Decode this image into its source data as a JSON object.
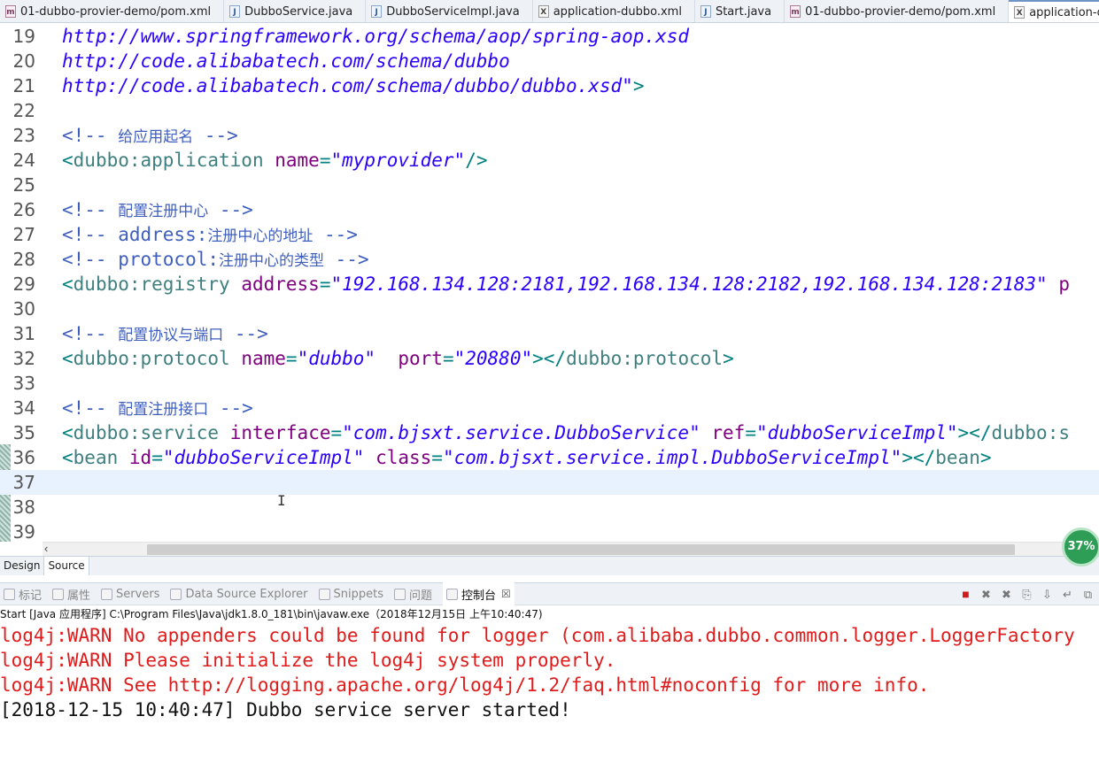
{
  "editor_tabs": [
    {
      "label": "01-dubbo-provier-demo/pom.xml",
      "icon": "maven-pom-icon",
      "type": "m"
    },
    {
      "label": "DubboService.java",
      "icon": "java-file-icon",
      "type": "j"
    },
    {
      "label": "DubboServiceImpl.java",
      "icon": "java-file-icon",
      "type": "j"
    },
    {
      "label": "application-dubbo.xml",
      "icon": "xml-file-icon",
      "type": "x"
    },
    {
      "label": "Start.java",
      "icon": "java-file-icon",
      "type": "j"
    },
    {
      "label": "01-dubbo-provier-demo/pom.xml",
      "icon": "maven-pom-icon",
      "type": "m"
    },
    {
      "label": "application-dubb",
      "icon": "xml-file-icon",
      "type": "x",
      "active": true
    }
  ],
  "code_lines": [
    {
      "n": "19",
      "segs": [
        [
          "url",
          "http://www.springframework.org/schema/aop/spring-aop.xsd"
        ]
      ]
    },
    {
      "n": "20",
      "segs": [
        [
          "url",
          "http://code.alibabatech.com/schema/dubbo"
        ]
      ]
    },
    {
      "n": "21",
      "segs": [
        [
          "url",
          "http://code.alibabatech.com/schema/dubbo/dubbo.xsd"
        ],
        [
          "val",
          "\""
        ],
        [
          "punct",
          ">"
        ]
      ]
    },
    {
      "n": "22",
      "segs": []
    },
    {
      "n": "23",
      "segs": [
        [
          "cmt",
          "<!-- "
        ],
        [
          "cmt-cn",
          "给应用起名"
        ],
        [
          "cmt",
          " -->"
        ]
      ]
    },
    {
      "n": "24",
      "segs": [
        [
          "punct",
          "<"
        ],
        [
          "tag",
          "dubbo:application"
        ],
        [
          "plain",
          " "
        ],
        [
          "attr",
          "name"
        ],
        [
          "punct",
          "="
        ],
        [
          "val",
          "\"myprovider\""
        ],
        [
          "punct",
          "/>"
        ]
      ]
    },
    {
      "n": "25",
      "segs": []
    },
    {
      "n": "26",
      "segs": [
        [
          "cmt",
          "<!-- "
        ],
        [
          "cmt-cn",
          "配置注册中心"
        ],
        [
          "cmt",
          " -->"
        ]
      ]
    },
    {
      "n": "27",
      "segs": [
        [
          "cmt",
          "<!-- address:"
        ],
        [
          "cmt-cn",
          "注册中心的地址"
        ],
        [
          "cmt",
          " -->"
        ]
      ]
    },
    {
      "n": "28",
      "segs": [
        [
          "cmt",
          "<!-- protocol:"
        ],
        [
          "cmt-cn",
          "注册中心的类型"
        ],
        [
          "cmt",
          " -->"
        ]
      ]
    },
    {
      "n": "29",
      "segs": [
        [
          "punct",
          "<"
        ],
        [
          "tag",
          "dubbo:registry"
        ],
        [
          "plain",
          " "
        ],
        [
          "attr",
          "address"
        ],
        [
          "punct",
          "="
        ],
        [
          "val",
          "\"192.168.134.128:2181,192.168.134.128:2182,192.168.134.128:2183\""
        ],
        [
          "plain",
          " "
        ],
        [
          "attr",
          "p"
        ]
      ]
    },
    {
      "n": "30",
      "segs": []
    },
    {
      "n": "31",
      "segs": [
        [
          "cmt",
          "<!-- "
        ],
        [
          "cmt-cn",
          "配置协议与端口"
        ],
        [
          "cmt",
          " -->"
        ]
      ]
    },
    {
      "n": "32",
      "segs": [
        [
          "punct",
          "<"
        ],
        [
          "tag",
          "dubbo:protocol"
        ],
        [
          "plain",
          " "
        ],
        [
          "attr",
          "name"
        ],
        [
          "punct",
          "="
        ],
        [
          "val",
          "\"dubbo\""
        ],
        [
          "plain",
          "  "
        ],
        [
          "attr",
          "port"
        ],
        [
          "punct",
          "="
        ],
        [
          "val",
          "\"20880\""
        ],
        [
          "punct",
          "></"
        ],
        [
          "tag",
          "dubbo:protocol"
        ],
        [
          "punct",
          ">"
        ]
      ]
    },
    {
      "n": "33",
      "segs": []
    },
    {
      "n": "34",
      "segs": [
        [
          "cmt",
          "<!-- "
        ],
        [
          "cmt-cn",
          "配置注册接口"
        ],
        [
          "cmt",
          " -->"
        ]
      ]
    },
    {
      "n": "35",
      "segs": [
        [
          "punct",
          "<"
        ],
        [
          "tag",
          "dubbo:service"
        ],
        [
          "plain",
          " "
        ],
        [
          "attr",
          "interface"
        ],
        [
          "punct",
          "="
        ],
        [
          "val",
          "\"com.bjsxt.service.DubboService\""
        ],
        [
          "plain",
          " "
        ],
        [
          "attr",
          "ref"
        ],
        [
          "punct",
          "="
        ],
        [
          "val",
          "\"dubboServiceImpl\""
        ],
        [
          "punct",
          "></"
        ],
        [
          "tag",
          "dubbo:s"
        ]
      ]
    },
    {
      "n": "36",
      "segs": [
        [
          "punct",
          "<"
        ],
        [
          "tag",
          "bean"
        ],
        [
          "plain",
          " "
        ],
        [
          "attr",
          "id"
        ],
        [
          "punct",
          "="
        ],
        [
          "val",
          "\"dubboServiceImpl\""
        ],
        [
          "plain",
          " "
        ],
        [
          "attr",
          "class"
        ],
        [
          "punct",
          "="
        ],
        [
          "val",
          "\"com.bjsxt.service.impl.DubboServiceImpl\""
        ],
        [
          "punct",
          "></"
        ],
        [
          "tag",
          "bean"
        ],
        [
          "punct",
          ">"
        ]
      ]
    },
    {
      "n": "37",
      "segs": [],
      "current": true
    },
    {
      "n": "38",
      "segs": []
    },
    {
      "n": "39",
      "segs": []
    }
  ],
  "editor_mode_tabs": {
    "design": "Design",
    "source": "Source"
  },
  "progress_badge": {
    "label": "37%",
    "value_percent": 37
  },
  "view_tabs": [
    {
      "label": "标记",
      "icon": "markers-icon"
    },
    {
      "label": "属性",
      "icon": "properties-icon"
    },
    {
      "label": "Servers",
      "icon": "servers-icon"
    },
    {
      "label": "Data Source Explorer",
      "icon": "data-source-icon"
    },
    {
      "label": "Snippets",
      "icon": "snippets-icon"
    },
    {
      "label": "问题",
      "icon": "problems-icon"
    },
    {
      "label": "控制台",
      "icon": "console-icon",
      "active": true,
      "close": "☒"
    }
  ],
  "console_tools": [
    {
      "name": "terminate-icon",
      "glyph": "■",
      "cls": "stop"
    },
    {
      "name": "remove-launch-icon",
      "glyph": "✖"
    },
    {
      "name": "remove-all-icon",
      "glyph": "✖"
    },
    {
      "name": "clear-console-icon",
      "glyph": "⎘"
    },
    {
      "name": "scroll-lock-icon",
      "glyph": "⇩"
    },
    {
      "name": "word-wrap-icon",
      "glyph": "↵"
    },
    {
      "name": "pin-console-icon",
      "glyph": "⧉"
    }
  ],
  "console": {
    "header": "Start [Java 应用程序] C:\\Program Files\\Java\\jdk1.8.0_181\\bin\\javaw.exe（2018年12月15日 上午10:40:47)",
    "lines": [
      {
        "kind": "err",
        "text": "log4j:WARN No appenders could be found for logger (com.alibaba.dubbo.common.logger.LoggerFactory"
      },
      {
        "kind": "err",
        "text": "log4j:WARN Please initialize the log4j system properly."
      },
      {
        "kind": "err",
        "text": "log4j:WARN See http://logging.apache.org/log4j/1.2/faq.html#noconfig for more info."
      },
      {
        "kind": "out",
        "text": "[2018-12-15 10:40:47] Dubbo service server started!"
      }
    ]
  }
}
